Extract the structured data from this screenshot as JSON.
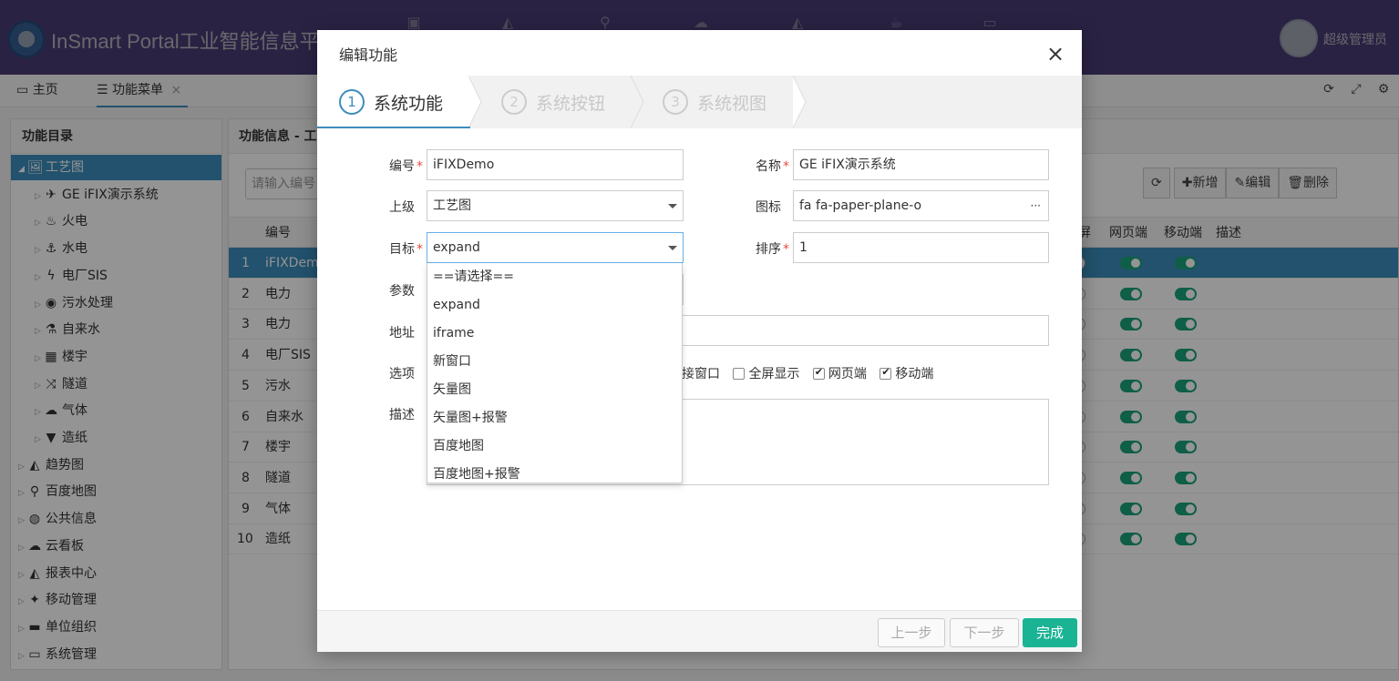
{
  "app": {
    "title": "InSmart Portal工业智能信息平",
    "user_name": "超级管理员"
  },
  "colors": {
    "header": "#5b4a93",
    "accent": "#3c8dbc",
    "success": "#1ab394",
    "toggle_on": "#1aa37a"
  },
  "topnav_icons": [
    "image-icon",
    "area-chart-icon",
    "map-marker-icon",
    "cloud-icon",
    "line-chart-icon",
    "coffee-icon",
    "monitor-icon"
  ],
  "tabs": [
    {
      "label": "主页",
      "icon": "desktop-icon"
    },
    {
      "label": "功能菜单",
      "icon": "bars-icon",
      "close": "×"
    }
  ],
  "left_panel": {
    "title": "功能目录",
    "tree": [
      {
        "label": "工艺图",
        "icon": "🖼",
        "arrow": "◢",
        "level": 0,
        "selected": true
      },
      {
        "label": "GE iFIX演示系统",
        "icon": "✈",
        "arrow": "▷",
        "level": 1
      },
      {
        "label": "火电",
        "icon": "♨",
        "arrow": "▷",
        "level": 1
      },
      {
        "label": "水电",
        "icon": "⚓",
        "arrow": "▷",
        "level": 1
      },
      {
        "label": "电厂SIS",
        "icon": "ϟ",
        "arrow": "▷",
        "level": 1
      },
      {
        "label": "污水处理",
        "icon": "◉",
        "arrow": "▷",
        "level": 1
      },
      {
        "label": "自来水",
        "icon": "⚗",
        "arrow": "▷",
        "level": 1
      },
      {
        "label": "楼宇",
        "icon": "▦",
        "arrow": "▷",
        "level": 1
      },
      {
        "label": "隧道",
        "icon": "⤨",
        "arrow": "▷",
        "level": 1
      },
      {
        "label": "气体",
        "icon": "☁",
        "arrow": "▷",
        "level": 1
      },
      {
        "label": "造纸",
        "icon": "▼",
        "arrow": "▷",
        "level": 1
      },
      {
        "label": "趋势图",
        "icon": "◭",
        "arrow": "▷",
        "level": 0
      },
      {
        "label": "百度地图",
        "icon": "⚲",
        "arrow": "▷",
        "level": 0
      },
      {
        "label": "公共信息",
        "icon": "◍",
        "arrow": "▷",
        "level": 0
      },
      {
        "label": "云看板",
        "icon": "☁",
        "arrow": "▷",
        "level": 0
      },
      {
        "label": "报表中心",
        "icon": "◭",
        "arrow": "▷",
        "level": 0
      },
      {
        "label": "移动管理",
        "icon": "✦",
        "arrow": "▷",
        "level": 0
      },
      {
        "label": "单位组织",
        "icon": "▬",
        "arrow": "▷",
        "level": 0
      },
      {
        "label": "系统管理",
        "icon": "▭",
        "arrow": "▷",
        "level": 0
      }
    ]
  },
  "right_panel": {
    "title": "功能信息 - 工",
    "search_placeholder": "请输入编号",
    "buttons": {
      "refresh": "⟳",
      "add": "✚新增",
      "edit": "✎编辑",
      "delete": "🗑删除"
    },
    "columns": {
      "code": "编号",
      "partial": "屏",
      "web": "网页端",
      "mobile": "移动端",
      "desc": "描述"
    },
    "rows": [
      {
        "num": "1",
        "code": "iFIXDem"
      },
      {
        "num": "2",
        "code": "电力"
      },
      {
        "num": "3",
        "code": "电力"
      },
      {
        "num": "4",
        "code": "电厂SIS"
      },
      {
        "num": "5",
        "code": "污水"
      },
      {
        "num": "6",
        "code": "自来水"
      },
      {
        "num": "7",
        "code": "楼宇"
      },
      {
        "num": "8",
        "code": "隧道"
      },
      {
        "num": "9",
        "code": "气体"
      },
      {
        "num": "10",
        "code": "造纸"
      }
    ]
  },
  "modal": {
    "title": "编辑功能",
    "close": "×",
    "steps": [
      {
        "num": "1",
        "label": "系统功能"
      },
      {
        "num": "2",
        "label": "系统按钮"
      },
      {
        "num": "3",
        "label": "系统视图"
      }
    ],
    "form": {
      "code_label": "编号",
      "code_value": "iFIXDemo",
      "name_label": "名称",
      "name_value": "GE iFIX演示系统",
      "parent_label": "上级",
      "parent_value": "工艺图",
      "icon_label": "图标",
      "icon_value": "fa fa-paper-plane-o",
      "icon_more": "···",
      "target_label": "目标",
      "target_value": "expand",
      "order_label": "排序",
      "order_value": "1",
      "param_label": "参数",
      "url_label": "地址",
      "options_label": "选项",
      "desc_label": "描述",
      "required_mark": "*",
      "options": [
        {
          "label": "接窗口",
          "checked": null
        },
        {
          "label": "全屏显示",
          "checked": false
        },
        {
          "label": "网页端",
          "checked": true
        },
        {
          "label": "移动端",
          "checked": true
        }
      ]
    },
    "target_options": [
      "==请选择==",
      "expand",
      "iframe",
      "新窗口",
      "矢量图",
      "矢量图+报警",
      "百度地图",
      "百度地图+报警"
    ],
    "footer": {
      "prev": "上一步",
      "next": "下一步",
      "finish": "完成"
    }
  }
}
